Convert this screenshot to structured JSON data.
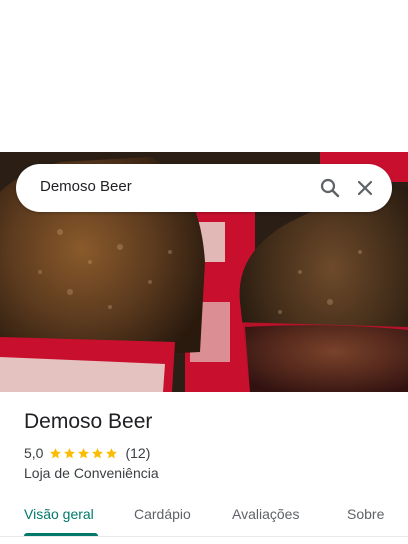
{
  "search": {
    "query": "Demoso Beer"
  },
  "icons": {
    "search": "search-icon",
    "close": "close-icon",
    "star": "star-icon"
  },
  "place": {
    "name": "Demoso Beer",
    "rating": "5,0",
    "stars": 5,
    "reviews": "(12)",
    "category": "Loja de Conveniência"
  },
  "tabs": [
    {
      "label": "Visão geral",
      "active": true
    },
    {
      "label": "Cardápio",
      "active": false
    },
    {
      "label": "Avaliações",
      "active": false
    },
    {
      "label": "Sobre",
      "active": false
    }
  ],
  "colors": {
    "accent": "#00796b",
    "star": "#fbbc04",
    "text": "#202124"
  }
}
